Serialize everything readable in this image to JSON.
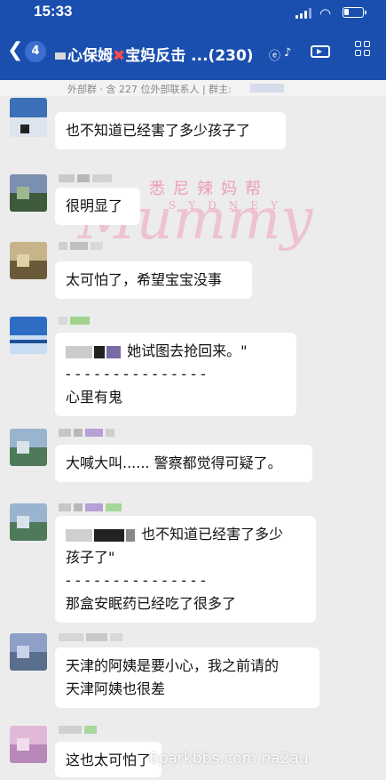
{
  "status": {
    "time": "15:33"
  },
  "header": {
    "back_icon": "chevron-left-icon",
    "unread_count": "4",
    "title": "心保姆",
    "title_mid": "宝妈反击 ...",
    "member_count": "(230)",
    "sub_info": "外部群 · 含 227 位外部联系人 | 群主:"
  },
  "watermark": {
    "brand": "悉尼辣妈帮",
    "sydney": "SYDNEY",
    "mummy": "Mummy"
  },
  "messages": [
    {
      "lines": [
        "也不知道已经害了多少孩子了"
      ]
    },
    {
      "lines": [
        "很明显了"
      ]
    },
    {
      "lines": [
        "太可怕了，希望宝宝没事"
      ]
    },
    {
      "lines": [
        "她试图去抢回来。\"",
        "- - - - - - - - - - - - - - -",
        "心里有鬼"
      ]
    },
    {
      "lines": [
        "大喊大叫...... 警察都觉得可疑了。"
      ]
    },
    {
      "lines": [
        "也不知道已经害了多少",
        "孩子了\"",
        "- - - - - - - - - - - - - - -",
        "那盒安眠药已经吃了很多了"
      ]
    },
    {
      "lines": [
        "天津的阿姨是要小心，我之前请的",
        "天津阿姨也很差"
      ]
    },
    {
      "lines": [
        "这也太可怕了"
      ]
    }
  ],
  "footer_watermark": "6parkbbs.com na2au"
}
